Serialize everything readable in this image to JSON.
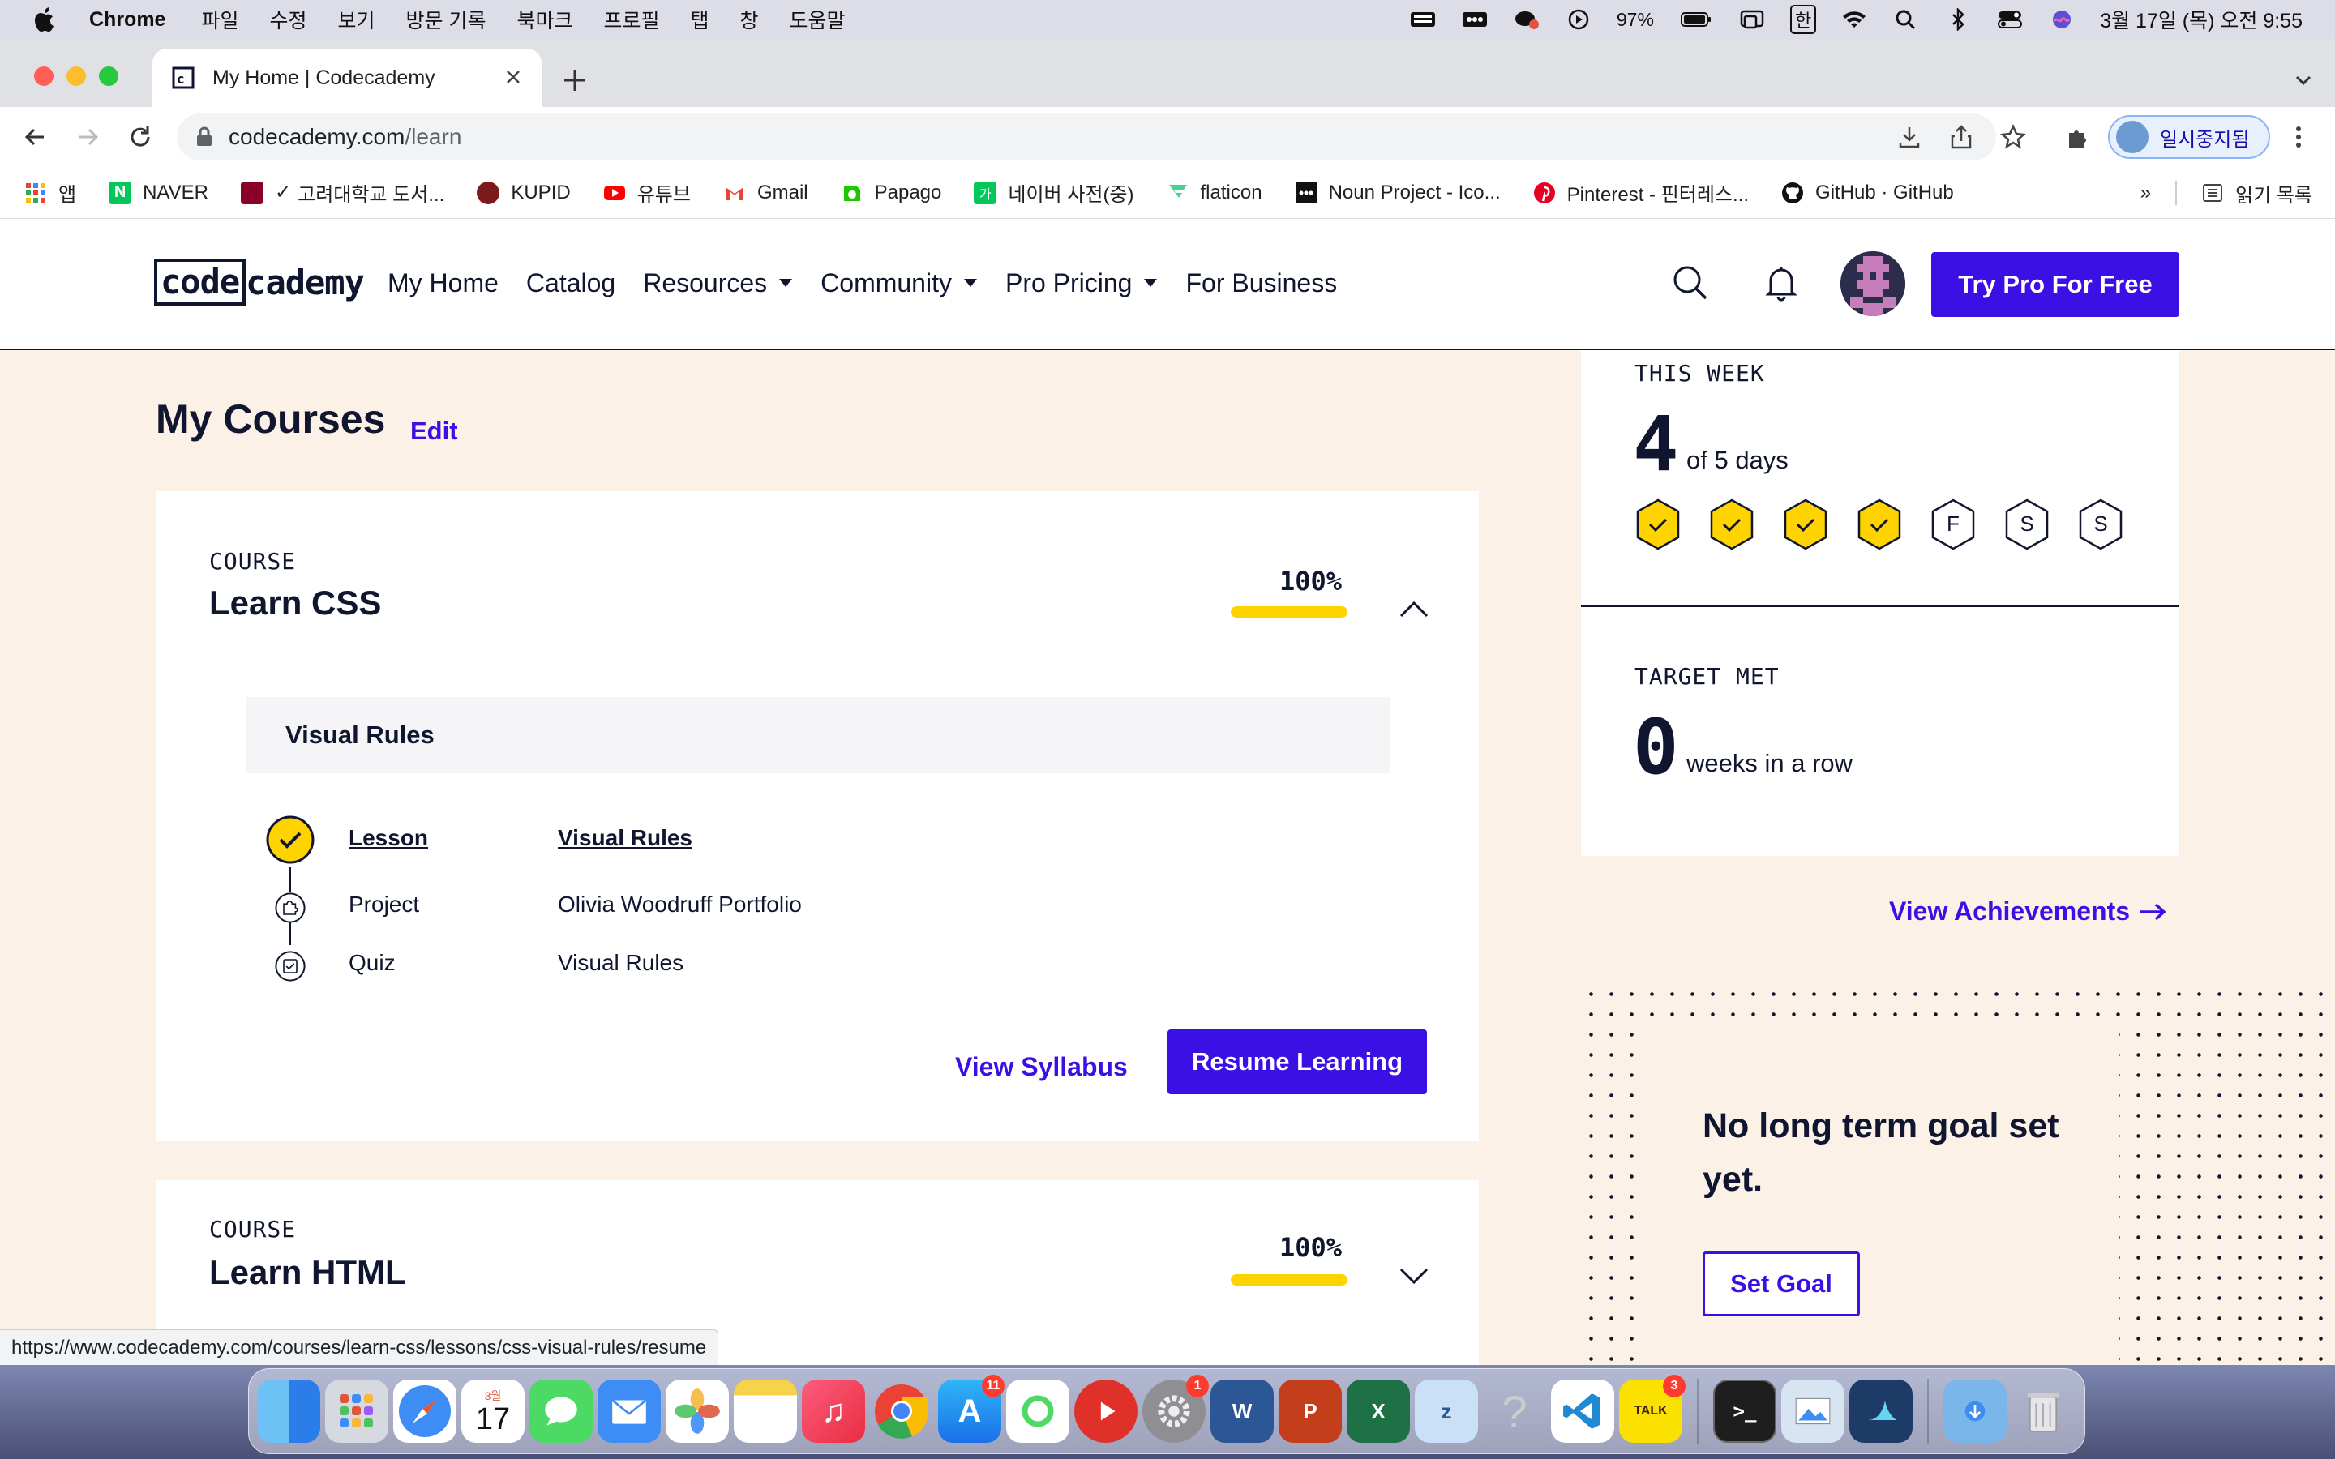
{
  "menubar": {
    "app_name": "Chrome",
    "menus": [
      "파일",
      "수정",
      "보기",
      "방문 기록",
      "북마크",
      "프로필",
      "탭",
      "창",
      "도움말"
    ],
    "battery": "97%",
    "input_source": "한",
    "datetime": "3월 17일 (목) 오전 9:55"
  },
  "browser": {
    "tab_title": "My Home | Codecademy",
    "url_host": "codecademy.com",
    "url_path": "/learn",
    "profile_label": "일시중지됨",
    "bookmarks": [
      "앱",
      "NAVER",
      "고려대학교 도서...",
      "KUPID",
      "유튜브",
      "Gmail",
      "Papago",
      "네이버 사전(중)",
      "flaticon",
      "Noun Project - Ico...",
      "Pinterest - 핀터레스...",
      "GitHub · GitHub"
    ],
    "bookmarks_more": "»",
    "reading_list": "읽기 목록",
    "status_url": "https://www.codecademy.com/courses/learn-css/lessons/css-visual-rules/resume"
  },
  "site": {
    "logo_left": "code",
    "logo_right": "cademy",
    "nav": {
      "my_home": "My Home",
      "catalog": "Catalog",
      "resources": "Resources",
      "community": "Community",
      "pro_pricing": "Pro Pricing",
      "for_business": "For Business"
    },
    "try_pro": "Try Pro For Free"
  },
  "courses": {
    "heading": "My Courses",
    "edit": "Edit",
    "items": [
      {
        "label": "COURSE",
        "name": "Learn CSS",
        "progress": "100%",
        "progress_value": 1.0,
        "module": "Visual Rules",
        "schedule": [
          {
            "type": "Lesson",
            "title": "Visual Rules",
            "status": "complete"
          },
          {
            "type": "Project",
            "title": "Olivia Woodruff Portfolio",
            "status": "todo"
          },
          {
            "type": "Quiz",
            "title": "Visual Rules",
            "status": "todo"
          }
        ],
        "view_syllabus": "View Syllabus",
        "resume": "Resume Learning"
      },
      {
        "label": "COURSE",
        "name": "Learn HTML",
        "progress": "100%",
        "progress_value": 1.0
      }
    ]
  },
  "weekly": {
    "this_week_label": "THIS WEEK",
    "days_count": "4",
    "days_text": "of 5 days",
    "days": [
      {
        "label": "",
        "done": true
      },
      {
        "label": "",
        "done": true
      },
      {
        "label": "",
        "done": true
      },
      {
        "label": "",
        "done": true
      },
      {
        "label": "F",
        "done": false
      },
      {
        "label": "S",
        "done": false
      },
      {
        "label": "S",
        "done": false
      }
    ],
    "target_label": "TARGET MET",
    "weeks_count": "0",
    "weeks_text": "weeks in a row"
  },
  "achievements_link": "View Achievements",
  "goal": {
    "text": "No long term goal set yet.",
    "button": "Set Goal"
  },
  "dock": {
    "badges": {
      "appstore": "11",
      "settings": "1",
      "kakaotalk": "3"
    },
    "calendar_month": "3월",
    "calendar_day": "17"
  },
  "colors": {
    "brand_blue": "#3a10e5",
    "navy": "#10162f",
    "yellow": "#ffd300",
    "beige": "#fbf1e6"
  }
}
